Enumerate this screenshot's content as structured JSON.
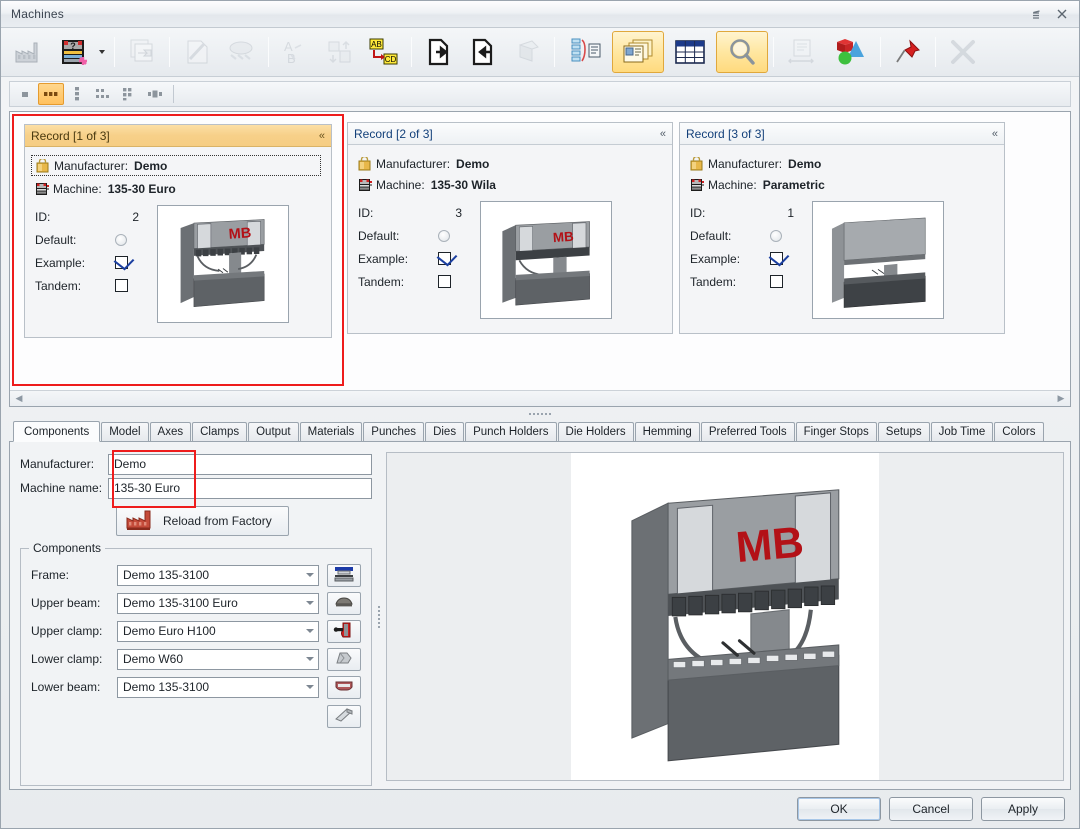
{
  "window": {
    "title": "Machines",
    "restore_label": "❐",
    "close_label": "✕"
  },
  "toolbar": {
    "buttons": [
      {
        "name": "factory-icon",
        "label": "Factory",
        "state": "normal"
      },
      {
        "name": "machine-question-icon",
        "label": "Machine Unknown",
        "state": "normal"
      },
      {
        "name": "dropdown-caret-icon",
        "label": "More",
        "state": "caret"
      },
      {
        "name": "copy-records-icon",
        "label": "Copy Records",
        "state": "disabled"
      },
      {
        "name": "edit-diagonal-icon",
        "label": "Edit",
        "state": "disabled"
      },
      {
        "name": "stamp-icon",
        "label": "Stamp",
        "state": "disabled"
      },
      {
        "name": "rename-ab-icon",
        "label": "Rename A to B",
        "state": "disabled"
      },
      {
        "name": "move-order-icon",
        "label": "Reorder",
        "state": "disabled"
      },
      {
        "name": "replace-abcd-icon",
        "label": "Replace AB with CD",
        "state": "normal"
      },
      {
        "name": "export-icon",
        "label": "Export",
        "state": "normal"
      },
      {
        "name": "import-icon",
        "label": "Import",
        "state": "normal"
      },
      {
        "name": "purge-icon",
        "label": "Purge",
        "state": "disabled"
      },
      {
        "name": "list-report-icon",
        "label": "Report",
        "state": "normal"
      },
      {
        "name": "card-view-icon",
        "label": "Card View",
        "state": "active"
      },
      {
        "name": "grid-view-icon",
        "label": "Grid View",
        "state": "normal"
      },
      {
        "name": "search-icon",
        "label": "Search",
        "state": "active"
      },
      {
        "name": "fit-width-icon",
        "label": "Fit Width",
        "state": "disabled"
      },
      {
        "name": "three-d-shapes-icon",
        "label": "3D View",
        "state": "normal"
      },
      {
        "name": "pin-icon",
        "label": "Pin",
        "state": "normal"
      },
      {
        "name": "cancel-x-icon",
        "label": "Cancel",
        "state": "disabled"
      }
    ]
  },
  "view_modes": [
    {
      "name": "view-single-icon",
      "label": "Single",
      "active": false
    },
    {
      "name": "view-row-icon",
      "label": "Row",
      "active": true
    },
    {
      "name": "view-column-icon",
      "label": "Column",
      "active": false
    },
    {
      "name": "view-grid-small-icon",
      "label": "Small Grid",
      "active": false
    },
    {
      "name": "view-grid-large-icon",
      "label": "Large Grid",
      "active": false
    },
    {
      "name": "view-detail-icon",
      "label": "Detail",
      "active": false
    }
  ],
  "records": {
    "scroll_left_arrow": "◀",
    "scroll_right_arrow": "▶",
    "collapse_chevron": "«",
    "cards": [
      {
        "header": "Record [1 of 3]",
        "manufacturer_label": "Manufacturer:",
        "manufacturer_value": "Demo",
        "machine_label": "Machine:",
        "machine_value": "135-30 Euro",
        "id_label": "ID:",
        "id_value": "2",
        "default_label": "Default:",
        "default_checked": false,
        "example_label": "Example:",
        "example_checked": true,
        "tandem_label": "Tandem:",
        "tandem_checked": false,
        "selected": true,
        "thumb_style": "euro"
      },
      {
        "header": "Record [2 of 3]",
        "manufacturer_label": "Manufacturer:",
        "manufacturer_value": "Demo",
        "machine_label": "Machine:",
        "machine_value": "135-30 Wila",
        "id_label": "ID:",
        "id_value": "3",
        "default_label": "Default:",
        "default_checked": false,
        "example_label": "Example:",
        "example_checked": true,
        "tandem_label": "Tandem:",
        "tandem_checked": false,
        "selected": false,
        "thumb_style": "wila"
      },
      {
        "header": "Record [3 of 3]",
        "manufacturer_label": "Manufacturer:",
        "manufacturer_value": "Demo",
        "machine_label": "Machine:",
        "machine_value": "Parametric",
        "id_label": "ID:",
        "id_value": "1",
        "default_label": "Default:",
        "default_checked": false,
        "example_label": "Example:",
        "example_checked": true,
        "tandem_label": "Tandem:",
        "tandem_checked": false,
        "selected": false,
        "thumb_style": "parametric"
      }
    ]
  },
  "tabs": [
    {
      "label": "Components",
      "active": true
    },
    {
      "label": "Model",
      "active": false
    },
    {
      "label": "Axes",
      "active": false
    },
    {
      "label": "Clamps",
      "active": false
    },
    {
      "label": "Output",
      "active": false
    },
    {
      "label": "Materials",
      "active": false
    },
    {
      "label": "Punches",
      "active": false
    },
    {
      "label": "Dies",
      "active": false
    },
    {
      "label": "Punch Holders",
      "active": false
    },
    {
      "label": "Die Holders",
      "active": false
    },
    {
      "label": "Hemming",
      "active": false
    },
    {
      "label": "Preferred Tools",
      "active": false
    },
    {
      "label": "Finger Stops",
      "active": false
    },
    {
      "label": "Setups",
      "active": false
    },
    {
      "label": "Job Time",
      "active": false
    },
    {
      "label": "Colors",
      "active": false
    }
  ],
  "components_tab": {
    "manufacturer_label": "Manufacturer:",
    "manufacturer_value": "Demo",
    "machine_name_label": "Machine name:",
    "machine_name_value": "135-30 Euro",
    "reload_button_label": "Reload from Factory",
    "group_title": "Components",
    "rows": [
      {
        "label": "Frame:",
        "value": "Demo 135-3100",
        "icon": "frame-icon"
      },
      {
        "label": "Upper beam:",
        "value": "Demo 135-3100 Euro",
        "icon": "upper-beam-icon"
      },
      {
        "label": "Upper clamp:",
        "value": "Demo Euro H100",
        "icon": "upper-clamp-icon"
      },
      {
        "label": "Lower clamp:",
        "value": "Demo W60",
        "icon": "lower-clamp-icon"
      },
      {
        "label": "Lower beam:",
        "value": "Demo 135-3100",
        "icon": "lower-beam-icon"
      }
    ],
    "extra_icon": "table-plate-icon"
  },
  "footer": {
    "ok_label": "OK",
    "cancel_label": "Cancel",
    "apply_label": "Apply"
  },
  "colors": {
    "highlight_red": "#ee1c1c",
    "selected_header": "#f7d089",
    "accent_blue": "#13407a",
    "logo_red": "#b31117"
  }
}
